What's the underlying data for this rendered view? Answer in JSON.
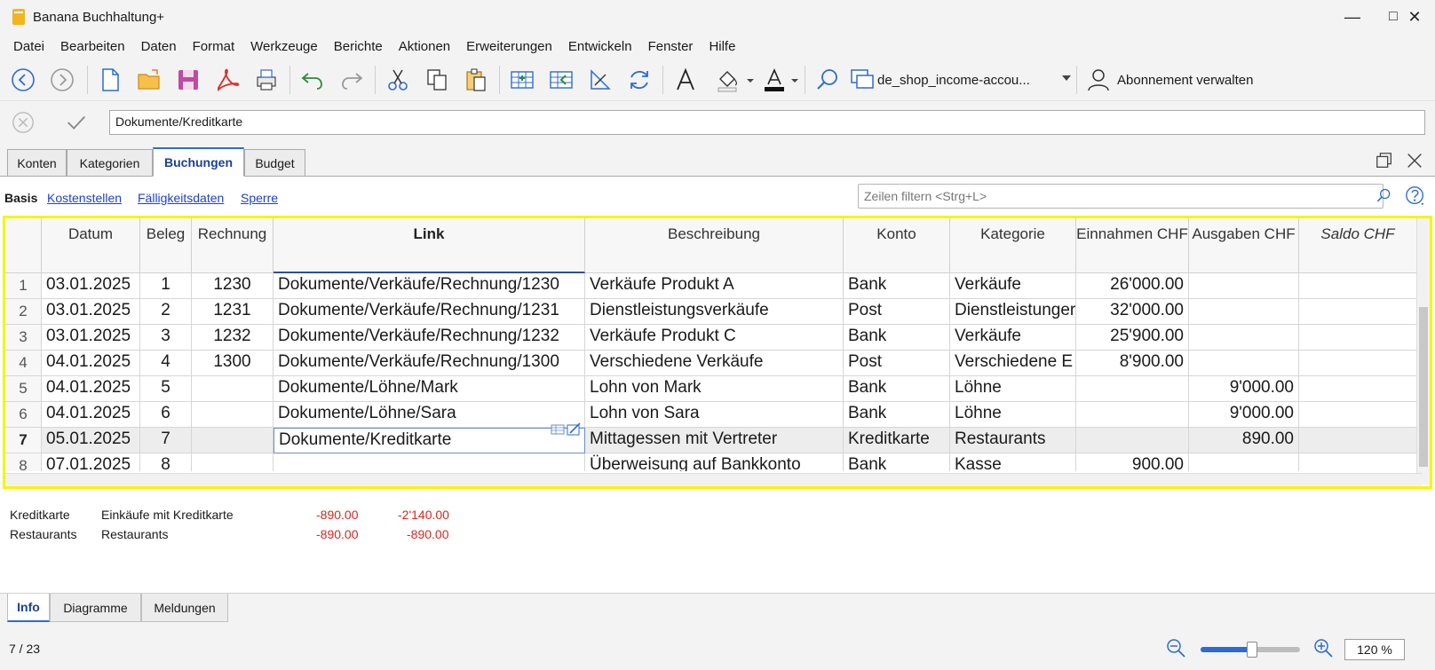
{
  "window": {
    "title": "Banana Buchhaltung+"
  },
  "menu": [
    {
      "label": "Datei"
    },
    {
      "label": "Bearbeiten"
    },
    {
      "label": "Daten"
    },
    {
      "label": "Format"
    },
    {
      "label": "Werkzeuge"
    },
    {
      "label": "Berichte"
    },
    {
      "label": "Aktionen"
    },
    {
      "label": "Erweiterungen"
    },
    {
      "label": "Entwickeln"
    },
    {
      "label": "Fenster"
    },
    {
      "label": "Hilfe"
    }
  ],
  "toolbar": {
    "file_name": "de_shop_income-accou...",
    "subscription": "Abonnement verwalten"
  },
  "editbar": {
    "value": "Dokumente/Kreditkarte"
  },
  "tabs": [
    {
      "label": "Konten"
    },
    {
      "label": "Kategorien"
    },
    {
      "label": "Buchungen"
    },
    {
      "label": "Budget"
    }
  ],
  "views": {
    "active": "Basis",
    "links": [
      "Kostenstellen",
      "Fälligkeitsdaten",
      "Sperre"
    ]
  },
  "filter": {
    "placeholder": "Zeilen filtern <Strg+L>"
  },
  "table": {
    "headers": {
      "datum": "Datum",
      "beleg": "Beleg",
      "rechnung": "Rechnung",
      "link": "Link",
      "beschreibung": "Beschreibung",
      "konto": "Konto",
      "kategorie": "Kategorie",
      "einnahmen": "Einnahmen CHF",
      "ausgaben": "Ausgaben CHF",
      "saldo": "Saldo CHF"
    },
    "rows": [
      {
        "n": "1",
        "datum": "03.01.2025",
        "beleg": "1",
        "rechnung": "1230",
        "link": "Dokumente/Verkäufe/Rechnung/1230",
        "beschreibung": "Verkäufe Produkt A",
        "konto": "Bank",
        "kategorie": "Verkäufe",
        "einnahmen": "26'000.00",
        "ausgaben": ""
      },
      {
        "n": "2",
        "datum": "03.01.2025",
        "beleg": "2",
        "rechnung": "1231",
        "link": "Dokumente/Verkäufe/Rechnung/1231",
        "beschreibung": "Dienstleistungsverkäufe",
        "konto": "Post",
        "kategorie": "Dienstleistunger",
        "einnahmen": "32'000.00",
        "ausgaben": ""
      },
      {
        "n": "3",
        "datum": "03.01.2025",
        "beleg": "3",
        "rechnung": "1232",
        "link": "Dokumente/Verkäufe/Rechnung/1232",
        "beschreibung": "Verkäufe Produkt C",
        "konto": "Bank",
        "kategorie": "Verkäufe",
        "einnahmen": "25'900.00",
        "ausgaben": ""
      },
      {
        "n": "4",
        "datum": "04.01.2025",
        "beleg": "4",
        "rechnung": "1300",
        "link": "Dokumente/Verkäufe/Rechnung/1300",
        "beschreibung": "Verschiedene Verkäufe",
        "konto": "Post",
        "kategorie": "Verschiedene E",
        "einnahmen": "8'900.00",
        "ausgaben": ""
      },
      {
        "n": "5",
        "datum": "04.01.2025",
        "beleg": "5",
        "rechnung": "",
        "link": "Dokumente/Löhne/Mark",
        "beschreibung": "Lohn von Mark",
        "konto": "Bank",
        "kategorie": "Löhne",
        "einnahmen": "",
        "ausgaben": "9'000.00"
      },
      {
        "n": "6",
        "datum": "04.01.2025",
        "beleg": "6",
        "rechnung": "",
        "link": "Dokumente/Löhne/Sara",
        "beschreibung": "Lohn von Sara",
        "konto": "Bank",
        "kategorie": "Löhne",
        "einnahmen": "",
        "ausgaben": "9'000.00"
      },
      {
        "n": "7",
        "datum": "05.01.2025",
        "beleg": "7",
        "rechnung": "",
        "link": "Dokumente/Kreditkarte",
        "beschreibung": "Mittagessen mit Vertreter",
        "konto": "Kreditkarte",
        "kategorie": "Restaurants",
        "einnahmen": "",
        "ausgaben": "890.00"
      },
      {
        "n": "8",
        "datum": "07.01.2025",
        "beleg": "8",
        "rechnung": "",
        "link": "",
        "beschreibung": "Überweisung auf Bankkonto",
        "konto": "Bank",
        "kategorie": "Kasse",
        "einnahmen": "900.00",
        "ausgaben": ""
      }
    ]
  },
  "info": [
    {
      "account": "Kreditkarte",
      "desc": "Einkäufe mit Kreditkarte",
      "amount": "-890.00",
      "balance": "-2'140.00"
    },
    {
      "account": "Restaurants",
      "desc": "Restaurants",
      "amount": "-890.00",
      "balance": "-890.00"
    }
  ],
  "bottom_tabs": [
    {
      "label": "Info"
    },
    {
      "label": "Diagramme"
    },
    {
      "label": "Meldungen"
    }
  ],
  "status": {
    "position": "7 / 23",
    "zoom": "120 %",
    "zoom_level": 0.52
  },
  "colors": {
    "accent": "#2d6bd4",
    "highlight_frame": "#f6f600",
    "negative": "#e0241b"
  }
}
